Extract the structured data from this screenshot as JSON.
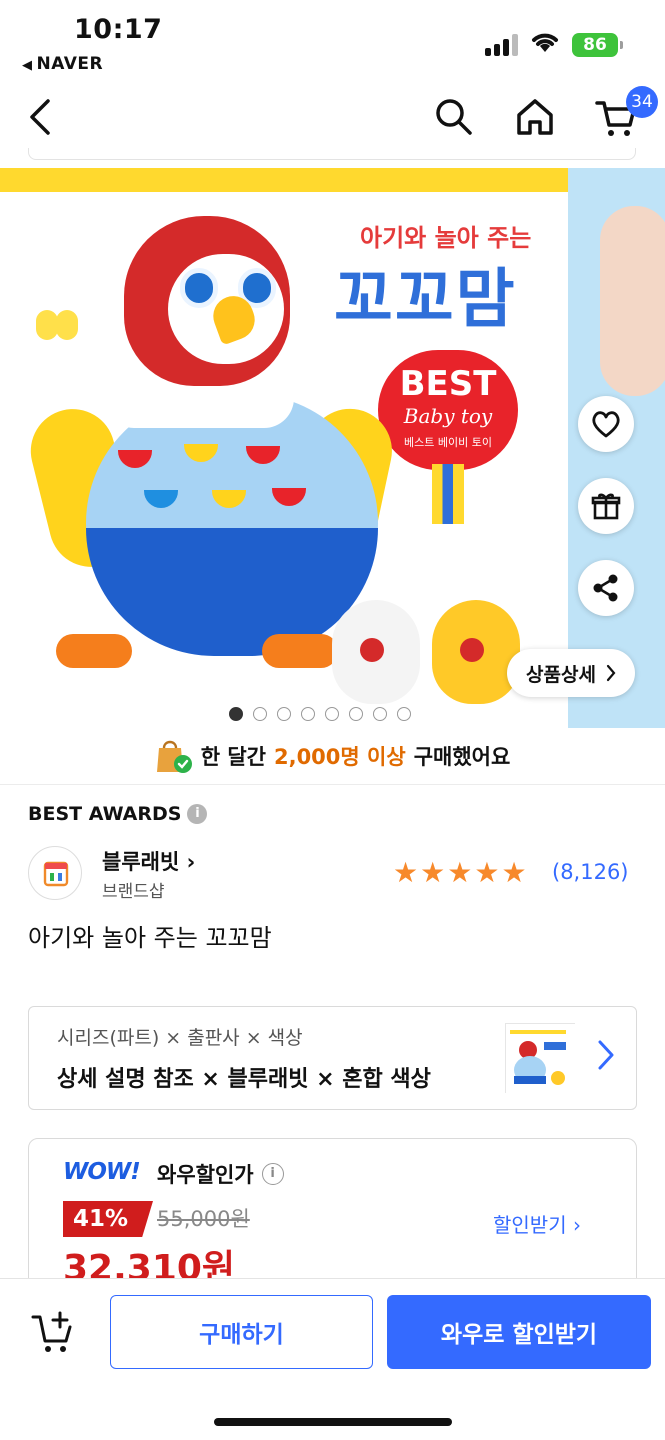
{
  "status": {
    "time": "10:17",
    "back_app": "NAVER",
    "battery": "86"
  },
  "nav": {
    "cart_count": "34"
  },
  "hero": {
    "box_title_small": "아기와 놀아 주는",
    "box_title_big": "꼬꼬맘",
    "badge_line1": "BEST",
    "badge_line2": "Baby toy",
    "badge_line3": "베스트 베이비 토이",
    "detail_button": "상품상세",
    "slide_count": 8,
    "slide_active": 1
  },
  "purchase_note": {
    "prefix": "한 달간",
    "highlight": "2,000명 이상",
    "suffix": "구매했어요"
  },
  "awards_label": "BEST AWARDS",
  "brand": {
    "name": "블루래빗",
    "sub": "브랜드샵"
  },
  "rating": {
    "stars": 5,
    "review_count": "(8,126)"
  },
  "product_title": "아기와 놀아 주는 꼬꼬맘",
  "options": {
    "header": "시리즈(파트) × 출판사 × 색상",
    "value": "상세 설명 참조 × 블루래빗 × 혼합 색상"
  },
  "price": {
    "wow_logo": "WOW!",
    "wow_label": "와우할인가",
    "discount": "41%",
    "original": "55,000원",
    "final": "32,310원",
    "get_discount": "할인받기"
  },
  "bottom": {
    "buy": "구매하기",
    "wow_buy": "와우로 할인받기"
  },
  "colors": {
    "accent": "#346aff",
    "sale_red": "#d01d1d",
    "star": "#f7892b",
    "highlight_orange": "#e06a00"
  }
}
